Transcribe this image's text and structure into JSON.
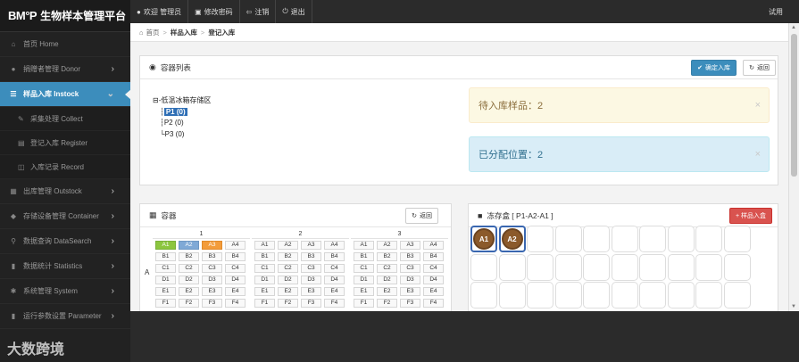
{
  "brand": {
    "logo": "BM°P",
    "title": "生物样本管理平台"
  },
  "sidebar": {
    "items": [
      {
        "icon": "home-icon",
        "glyph": "⌂",
        "label": "首页 Home",
        "chevron": false
      },
      {
        "icon": "user-icon",
        "glyph": "●",
        "label": "捐赠者管理 Donor",
        "chevron": true
      },
      {
        "icon": "list-icon",
        "glyph": "☰",
        "label": "样品入库 Instock",
        "chevron": true,
        "active": true
      }
    ],
    "sub": [
      {
        "icon": "pin-icon",
        "glyph": "✎",
        "label": "采集处理 Collect"
      },
      {
        "icon": "register-icon",
        "glyph": "▤",
        "label": "登记入库 Register"
      },
      {
        "icon": "record-icon",
        "glyph": "◫",
        "label": "入库记录 Record"
      }
    ],
    "items2": [
      {
        "icon": "grid-icon",
        "glyph": "▦",
        "label": "出库管理 Outstock"
      },
      {
        "icon": "tag-icon",
        "glyph": "◆",
        "label": "存储设备管理 Container"
      },
      {
        "icon": "search-icon",
        "glyph": "⚲",
        "label": "数据查询 DataSearch"
      },
      {
        "icon": "bar-chart-icon",
        "glyph": "▮",
        "label": "数据统计 Statistics"
      },
      {
        "icon": "gear-icon",
        "glyph": "✱",
        "label": "系统管理 System"
      },
      {
        "icon": "parameter-icon",
        "glyph": "▮",
        "label": "运行参数设置 Parameter"
      }
    ],
    "watermark": "大数跨境"
  },
  "topbar": {
    "welcome": "欢迎 管理员",
    "change_password": "修改密码",
    "logout_cancel": "注销",
    "exit": "退出",
    "right": "试用"
  },
  "breadcrumb": {
    "home": "首页",
    "level1": "样品入库",
    "level2": "登记入库"
  },
  "container_list": {
    "title": "容器列表",
    "confirm_btn": "确定入库",
    "back_btn": "返回",
    "tree_root": "⊟-低温冰箱存储区",
    "tree_nodes": [
      "P1 (0)",
      "P2 (0)",
      "P3 (0)"
    ],
    "pending_label": "待入库样品：2",
    "allocated_label": "已分配位置：2",
    "close_glyph": "×"
  },
  "container": {
    "title": "容器",
    "back_btn": "返回",
    "row_label": "A",
    "blocks": [
      {
        "head": "1",
        "rows": [
          [
            {
              "t": "A1",
              "c": "green"
            },
            {
              "t": "A2",
              "c": "blue"
            },
            {
              "t": "A3",
              "c": "orange"
            },
            {
              "t": "A4",
              "c": ""
            }
          ],
          [
            {
              "t": "B1",
              "c": ""
            },
            {
              "t": "B2",
              "c": ""
            },
            {
              "t": "B3",
              "c": ""
            },
            {
              "t": "B4",
              "c": ""
            }
          ],
          [
            {
              "t": "C1",
              "c": ""
            },
            {
              "t": "C2",
              "c": ""
            },
            {
              "t": "C3",
              "c": ""
            },
            {
              "t": "C4",
              "c": ""
            }
          ],
          [
            {
              "t": "D1",
              "c": ""
            },
            {
              "t": "D2",
              "c": ""
            },
            {
              "t": "D3",
              "c": ""
            },
            {
              "t": "D4",
              "c": ""
            }
          ],
          [
            {
              "t": "E1",
              "c": ""
            },
            {
              "t": "E2",
              "c": ""
            },
            {
              "t": "E3",
              "c": ""
            },
            {
              "t": "E4",
              "c": ""
            }
          ],
          [
            {
              "t": "F1",
              "c": ""
            },
            {
              "t": "F2",
              "c": ""
            },
            {
              "t": "F3",
              "c": ""
            },
            {
              "t": "F4",
              "c": ""
            }
          ]
        ]
      },
      {
        "head": "2",
        "rows": [
          [
            {
              "t": "A1",
              "c": ""
            },
            {
              "t": "A2",
              "c": ""
            },
            {
              "t": "A3",
              "c": ""
            },
            {
              "t": "A4",
              "c": ""
            }
          ],
          [
            {
              "t": "B1",
              "c": ""
            },
            {
              "t": "B2",
              "c": ""
            },
            {
              "t": "B3",
              "c": ""
            },
            {
              "t": "B4",
              "c": ""
            }
          ],
          [
            {
              "t": "C1",
              "c": ""
            },
            {
              "t": "C2",
              "c": ""
            },
            {
              "t": "C3",
              "c": ""
            },
            {
              "t": "C4",
              "c": ""
            }
          ],
          [
            {
              "t": "D1",
              "c": ""
            },
            {
              "t": "D2",
              "c": ""
            },
            {
              "t": "D3",
              "c": ""
            },
            {
              "t": "D4",
              "c": ""
            }
          ],
          [
            {
              "t": "E1",
              "c": ""
            },
            {
              "t": "E2",
              "c": ""
            },
            {
              "t": "E3",
              "c": ""
            },
            {
              "t": "E4",
              "c": ""
            }
          ],
          [
            {
              "t": "F1",
              "c": ""
            },
            {
              "t": "F2",
              "c": ""
            },
            {
              "t": "F3",
              "c": ""
            },
            {
              "t": "F4",
              "c": ""
            }
          ]
        ]
      },
      {
        "head": "3",
        "rows": [
          [
            {
              "t": "A1",
              "c": ""
            },
            {
              "t": "A2",
              "c": ""
            },
            {
              "t": "A3",
              "c": ""
            },
            {
              "t": "A4",
              "c": ""
            }
          ],
          [
            {
              "t": "B1",
              "c": ""
            },
            {
              "t": "B2",
              "c": ""
            },
            {
              "t": "B3",
              "c": ""
            },
            {
              "t": "B4",
              "c": ""
            }
          ],
          [
            {
              "t": "C1",
              "c": ""
            },
            {
              "t": "C2",
              "c": ""
            },
            {
              "t": "C3",
              "c": ""
            },
            {
              "t": "C4",
              "c": ""
            }
          ],
          [
            {
              "t": "D1",
              "c": ""
            },
            {
              "t": "D2",
              "c": ""
            },
            {
              "t": "D3",
              "c": ""
            },
            {
              "t": "D4",
              "c": ""
            }
          ],
          [
            {
              "t": "E1",
              "c": ""
            },
            {
              "t": "E2",
              "c": ""
            },
            {
              "t": "E3",
              "c": ""
            },
            {
              "t": "E4",
              "c": ""
            }
          ],
          [
            {
              "t": "F1",
              "c": ""
            },
            {
              "t": "F2",
              "c": ""
            },
            {
              "t": "F3",
              "c": ""
            },
            {
              "t": "F4",
              "c": ""
            }
          ]
        ]
      }
    ]
  },
  "freezer_box": {
    "title": "冻存盒 [ P1-A2-A1 ]",
    "add_btn": "+ 样品入盒",
    "tubes": [
      "A1",
      "A2"
    ],
    "total_cells": 30
  }
}
